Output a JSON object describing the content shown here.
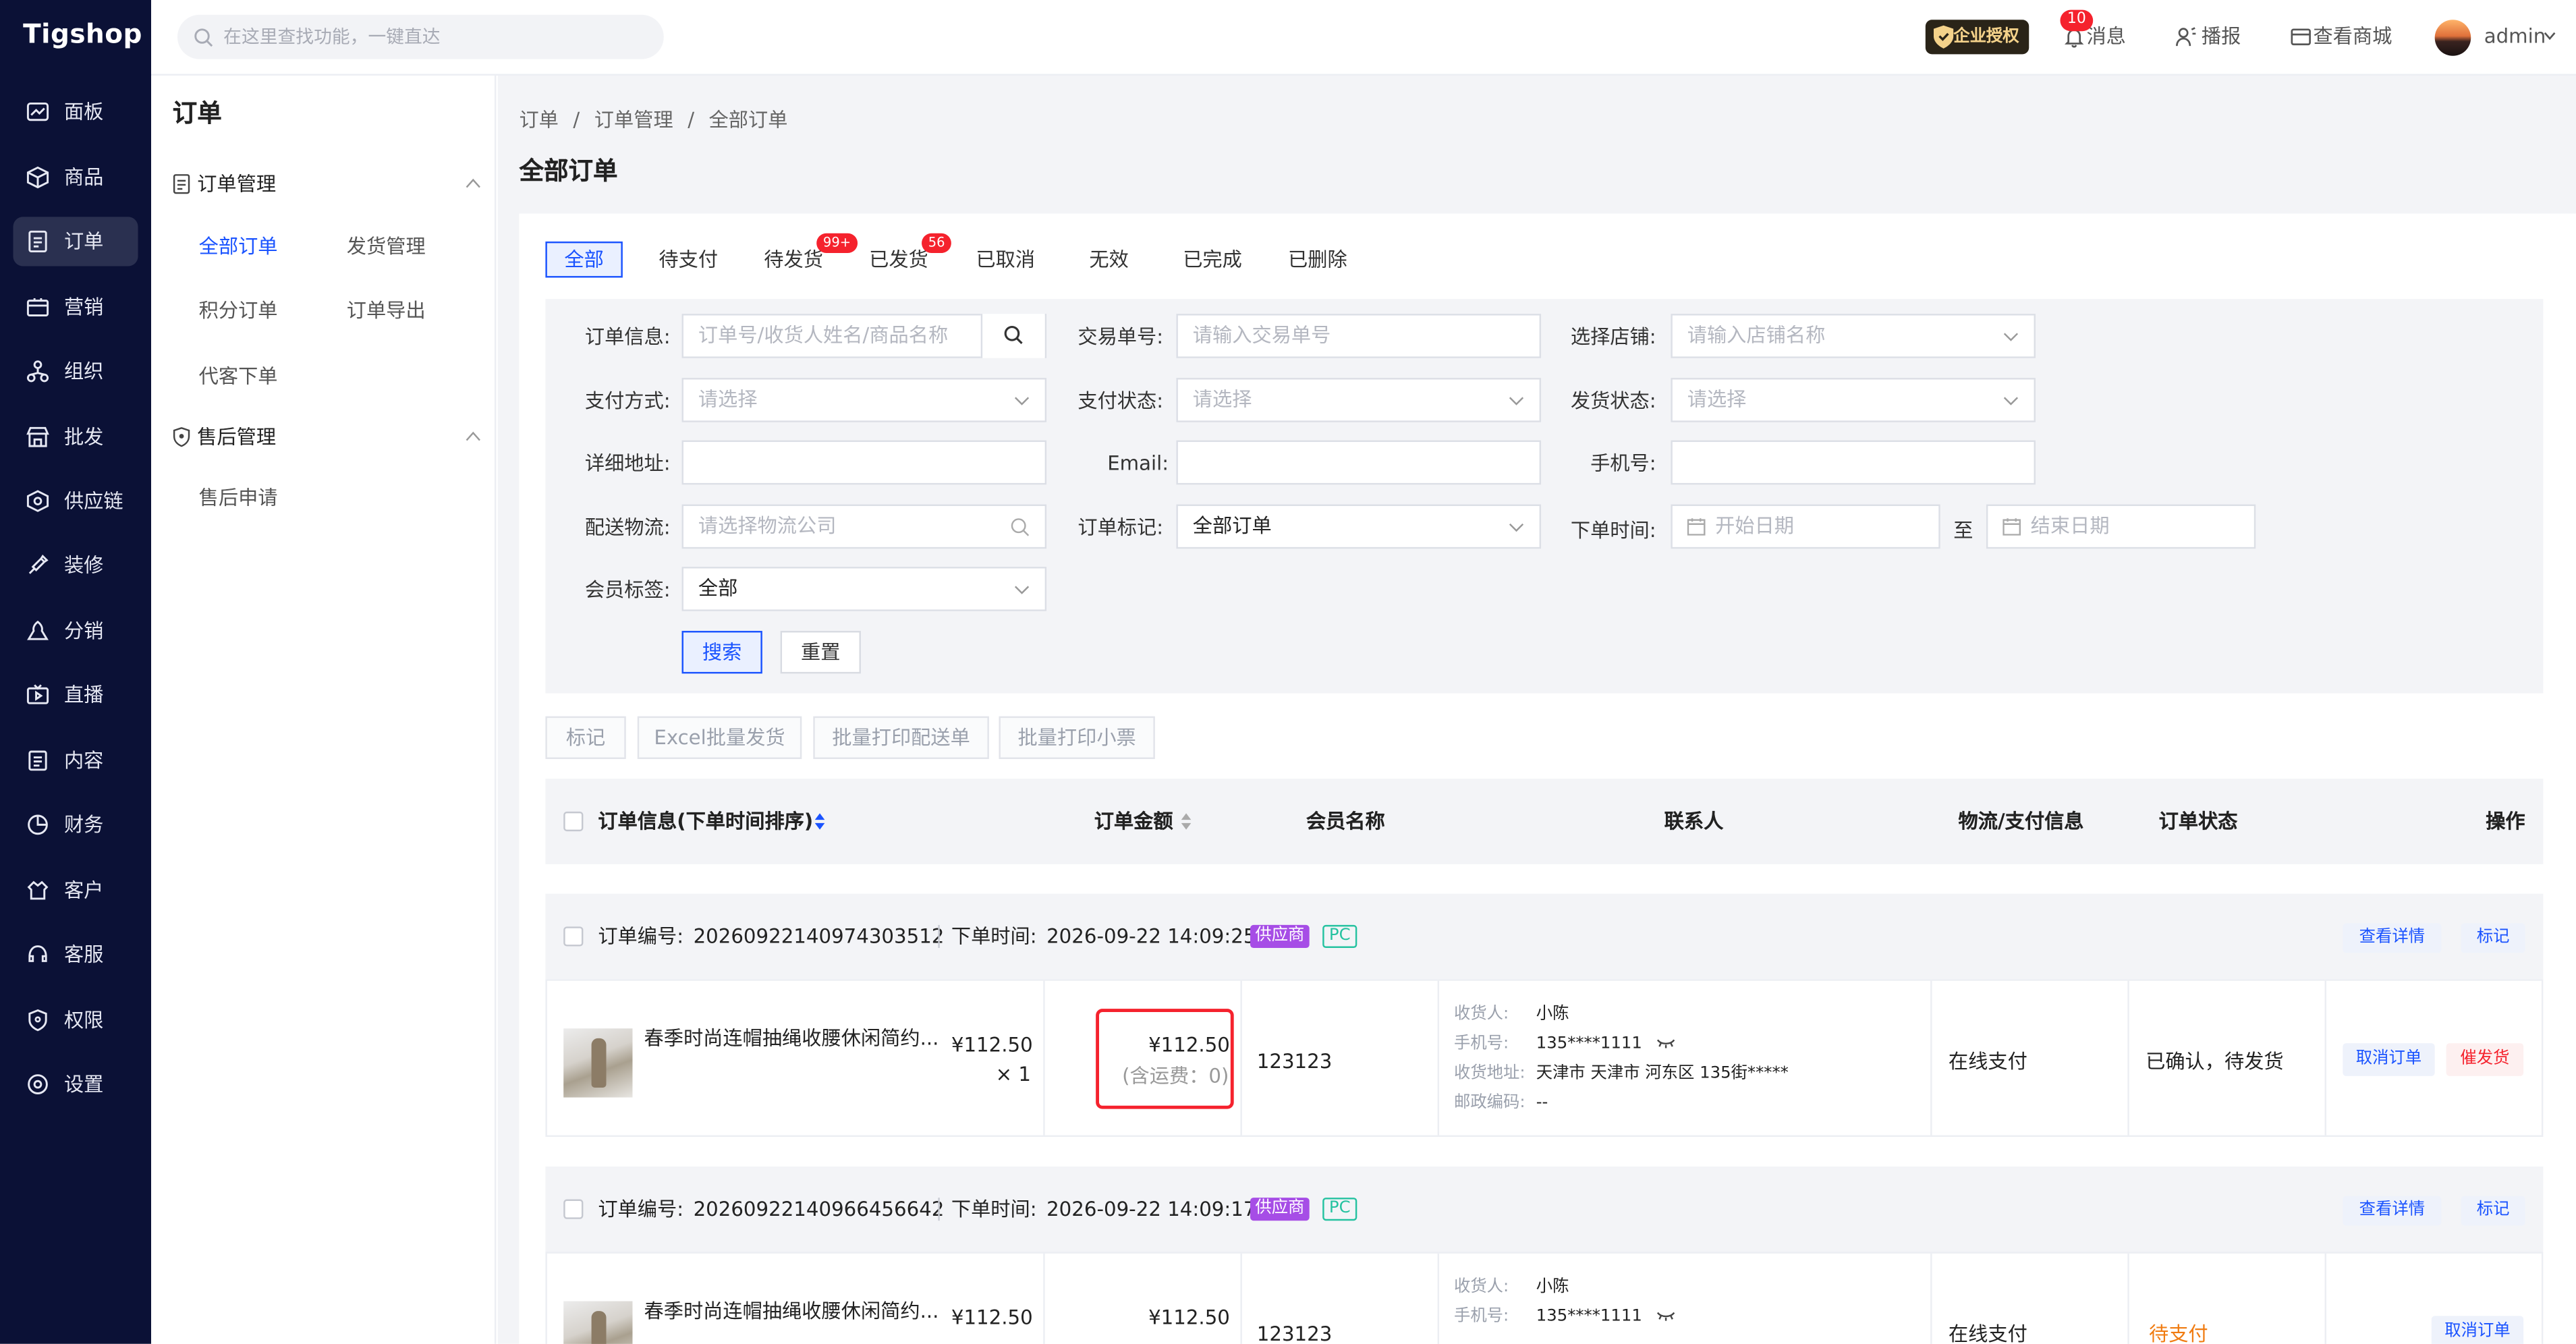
{
  "brand": {
    "logo_text": "Tigshop"
  },
  "nav": {
    "items": [
      {
        "label": "面板",
        "icon": "dashboard-icon"
      },
      {
        "label": "商品",
        "icon": "box-icon"
      },
      {
        "label": "订单",
        "icon": "order-icon",
        "active": true
      },
      {
        "label": "营销",
        "icon": "marketing-icon"
      },
      {
        "label": "组织",
        "icon": "organization-icon"
      },
      {
        "label": "批发",
        "icon": "store-icon"
      },
      {
        "label": "供应链",
        "icon": "supply-chain-icon"
      },
      {
        "label": "装修",
        "icon": "decorate-icon"
      },
      {
        "label": "分销",
        "icon": "distribution-icon"
      },
      {
        "label": "直播",
        "icon": "live-icon"
      },
      {
        "label": "内容",
        "icon": "content-icon"
      },
      {
        "label": "财务",
        "icon": "finance-icon"
      },
      {
        "label": "客户",
        "icon": "customer-icon"
      },
      {
        "label": "客服",
        "icon": "service-icon"
      },
      {
        "label": "权限",
        "icon": "permission-icon"
      },
      {
        "label": "设置",
        "icon": "settings-icon"
      }
    ]
  },
  "header": {
    "search_placeholder": "在这里查找功能，一键直达",
    "enterprise_label": "企业授权",
    "messages_label": "消息",
    "messages_count": "10",
    "broadcast_label": "播报",
    "view_store_label": "查看商城",
    "user_name": "admin"
  },
  "subnav": {
    "title": "订单",
    "group1": {
      "label": "订单管理",
      "items": [
        "全部订单",
        "发货管理",
        "积分订单",
        "订单导出",
        "代客下单"
      ]
    },
    "group2": {
      "label": "售后管理",
      "items": [
        "售后申请"
      ]
    }
  },
  "breadcrumb": {
    "a": "订单",
    "b": "订单管理",
    "c": "全部订单",
    "sep": "/"
  },
  "page_title": "全部订单",
  "tabs": [
    {
      "label": "全部",
      "active": true
    },
    {
      "label": "待支付"
    },
    {
      "label": "待发货",
      "badge": "99+"
    },
    {
      "label": "已发货",
      "badge": "56"
    },
    {
      "label": "已取消"
    },
    {
      "label": "无效"
    },
    {
      "label": "已完成"
    },
    {
      "label": "已删除"
    }
  ],
  "filters": {
    "order_info_label": "订单信息:",
    "order_info_placeholder": "订单号/收货人姓名/商品名称",
    "trade_no_label": "交易单号:",
    "trade_no_placeholder": "请输入交易单号",
    "shop_label": "选择店铺:",
    "shop_placeholder": "请输入店铺名称",
    "pay_method_label": "支付方式:",
    "pay_method_placeholder": "请选择",
    "pay_status_label": "支付状态:",
    "pay_status_placeholder": "请选择",
    "ship_status_label": "发货状态:",
    "ship_status_placeholder": "请选择",
    "address_label": "详细地址:",
    "email_label": "Email:",
    "phone_label": "手机号:",
    "logistics_label": "配送物流:",
    "logistics_placeholder": "请选择物流公司",
    "order_mark_label": "订单标记:",
    "order_mark_value": "全部订单",
    "order_time_label": "下单时间:",
    "start_date_placeholder": "开始日期",
    "to_label": "至",
    "end_date_placeholder": "结束日期",
    "member_tag_label": "会员标签:",
    "member_tag_value": "全部",
    "search_button": "搜索",
    "reset_button": "重置"
  },
  "bulk_actions": {
    "mark": "标记",
    "excel_ship": "Excel批量发货",
    "print_delivery": "批量打印配送单",
    "print_receipt": "批量打印小票"
  },
  "table_headers": {
    "order_info": "订单信息(下单时间排序)",
    "amount": "订单金额",
    "member": "会员名称",
    "contact": "联系人",
    "logistics_pay": "物流/支付信息",
    "status": "订单状态",
    "actions": "操作"
  },
  "orders": [
    {
      "order_no_label": "订单编号:",
      "order_no": "20260922140974303512",
      "order_time_label": "下单时间:",
      "order_time": "2026-09-22 14:09:25",
      "tag_supplier": "供应商",
      "tag_pc": "PC",
      "view_detail": "查看详情",
      "mark": "标记",
      "product_name": "春季时尚连帽抽绳收腰休闲简约...",
      "price": "¥112.50",
      "qty": "× 1",
      "amount": "¥112.50",
      "shipping_note": "(含运费：0)",
      "member": "123123",
      "receiver_label": "收货人:",
      "receiver": "小陈",
      "phone_label": "手机号:",
      "phone": "135****1111",
      "address_label": "收货地址:",
      "address": "天津市 天津市 河东区 135街*****",
      "zip_label": "邮政编码:",
      "zip": "--",
      "pay_info": "在线支付",
      "status": "已确认，待发货",
      "action1": "取消订单",
      "action2": "催发货"
    },
    {
      "order_no_label": "订单编号:",
      "order_no": "20260922140966456642",
      "order_time_label": "下单时间:",
      "order_time": "2026-09-22 14:09:17",
      "tag_supplier": "供应商",
      "tag_pc": "PC",
      "view_detail": "查看详情",
      "mark": "标记",
      "product_name": "春季时尚连帽抽绳收腰休闲简约...",
      "price": "¥112.50",
      "amount": "¥112.50",
      "member": "123123",
      "receiver_label": "收货人:",
      "receiver": "小陈",
      "phone_label": "手机号:",
      "phone": "135****1111",
      "pay_info": "在线支付",
      "status": "待支付",
      "action1": "取消订单"
    }
  ],
  "colors": {
    "rail_bg": "#0b1136",
    "accent": "#1a53ff",
    "danger": "#f5222d",
    "pending": "#f07c12",
    "supplier_tag": "#a64de6",
    "pc_tag": "#25c2a0"
  }
}
